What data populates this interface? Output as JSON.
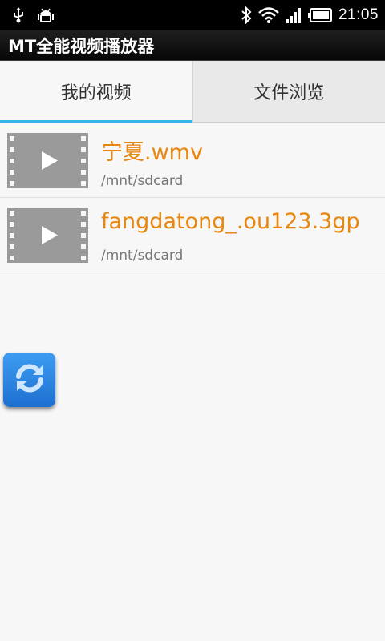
{
  "status_bar": {
    "time": "21:05",
    "icons": [
      "usb-icon",
      "android-debug-icon",
      "bluetooth-icon",
      "wifi-icon",
      "signal-icon",
      "battery-icon"
    ]
  },
  "app": {
    "title": "MT全能视频播放器"
  },
  "tabs": [
    {
      "label": "我的视频",
      "active": true
    },
    {
      "label": "文件浏览",
      "active": false
    }
  ],
  "videos": [
    {
      "title": "宁夏.wmv",
      "path": "/mnt/sdcard"
    },
    {
      "title": "fangdatong_.ou123.3gp",
      "path": "/mnt/sdcard"
    }
  ],
  "colors": {
    "accent": "#33b5e5",
    "title_text": "#e8860e",
    "refresh_button": "#2a86e6"
  },
  "floating_button": {
    "icon": "refresh-icon"
  }
}
